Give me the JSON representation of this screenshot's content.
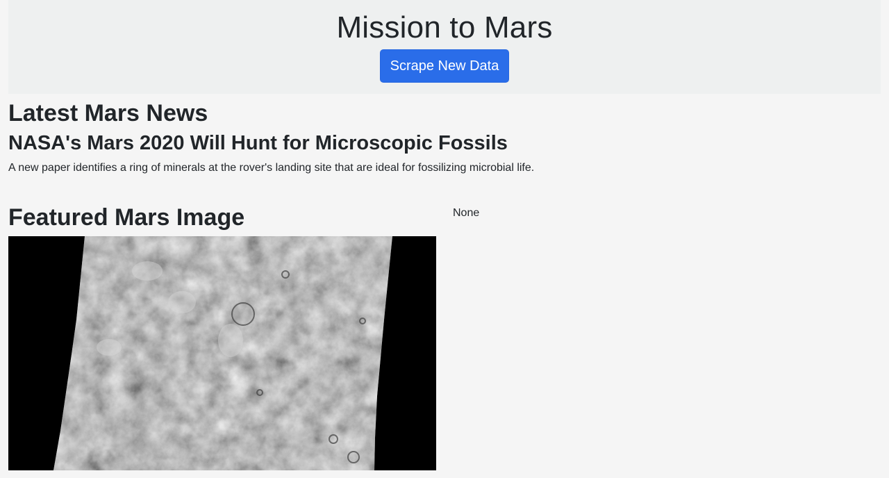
{
  "header": {
    "title": "Mission to Mars",
    "scrape_button": "Scrape New Data"
  },
  "news": {
    "section_heading": "Latest Mars News",
    "title": "NASA's Mars 2020 Will Hunt for Microscopic Fossils",
    "teaser": "A new paper identifies a ring of minerals at the rover's landing site that are ideal for fossilizing microbial life."
  },
  "featured": {
    "section_heading": "Featured Mars Image"
  },
  "facts": {
    "text": "None"
  },
  "colors": {
    "page_background": "#f5f5f5",
    "header_background": "#eef0f0",
    "button_primary": "#2a6de9",
    "text": "#212529"
  }
}
